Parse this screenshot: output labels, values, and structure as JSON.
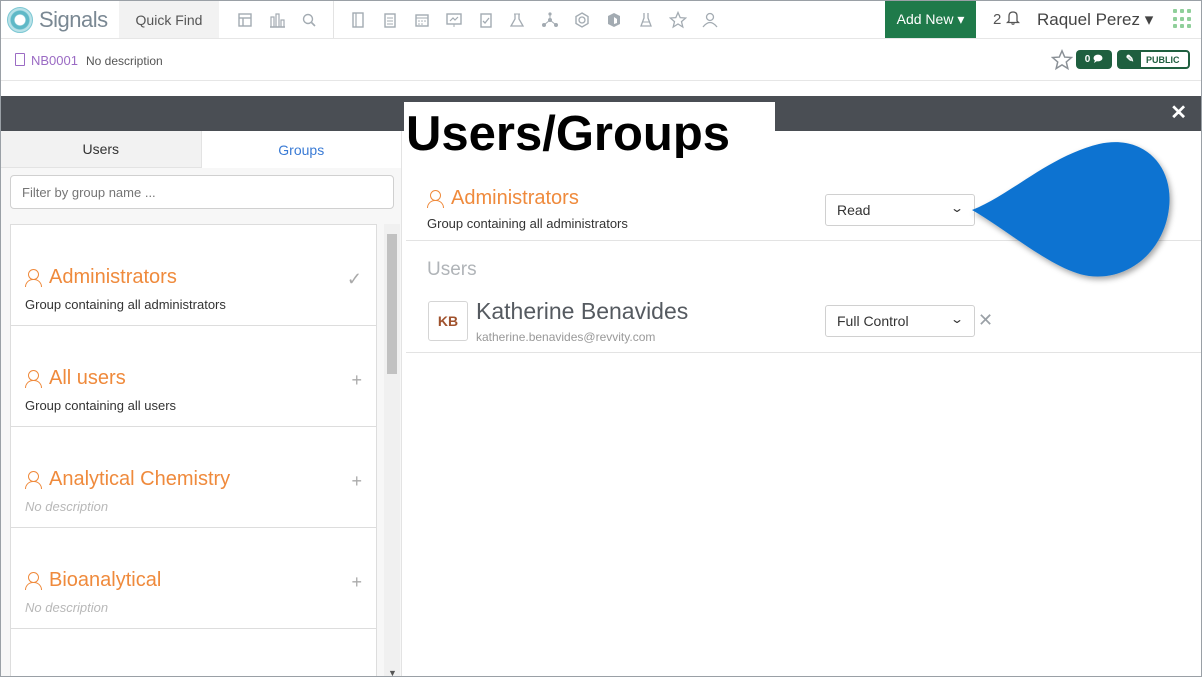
{
  "topbar": {
    "logo_text": "Signals",
    "quick_find": "Quick Find",
    "add_new": "Add New ▾",
    "notifications_count": "2",
    "user_name": "Raquel Perez ▾"
  },
  "notebook": {
    "id": "NB0001",
    "description": "No description",
    "comments_count": "0",
    "visibility": "PUBLIC"
  },
  "dialog": {
    "title": "Users/Groups",
    "close": "✕"
  },
  "left_panel": {
    "tabs": [
      {
        "label": "Users"
      },
      {
        "label": "Groups"
      }
    ],
    "filter_placeholder": "Filter by group name ...",
    "groups": [
      {
        "name": "Administrators",
        "description": "Group containing all administrators",
        "action": "✓"
      },
      {
        "name": "All users",
        "description": "Group containing all users",
        "action": "+"
      },
      {
        "name": "Analytical Chemistry",
        "description": "No description",
        "action": "+"
      },
      {
        "name": "Bioanalytical",
        "description": "No description",
        "action": "+"
      }
    ]
  },
  "right_panel": {
    "group": {
      "name": "Administrators",
      "description": "Group containing all administrators",
      "permission": "Read"
    },
    "users_heading": "Users",
    "users": [
      {
        "initials": "KB",
        "name": "Katherine Benavides",
        "email": "katherine.benavides@revvity.com",
        "permission": "Full Control",
        "remove": "✕"
      }
    ]
  },
  "colors": {
    "accent_orange": "#ef8a3c",
    "header_dark": "#4a4e54",
    "add_new_green": "#1f7a4a",
    "callout_blue": "#0a73d1",
    "link_blue": "#3a7bd5"
  }
}
